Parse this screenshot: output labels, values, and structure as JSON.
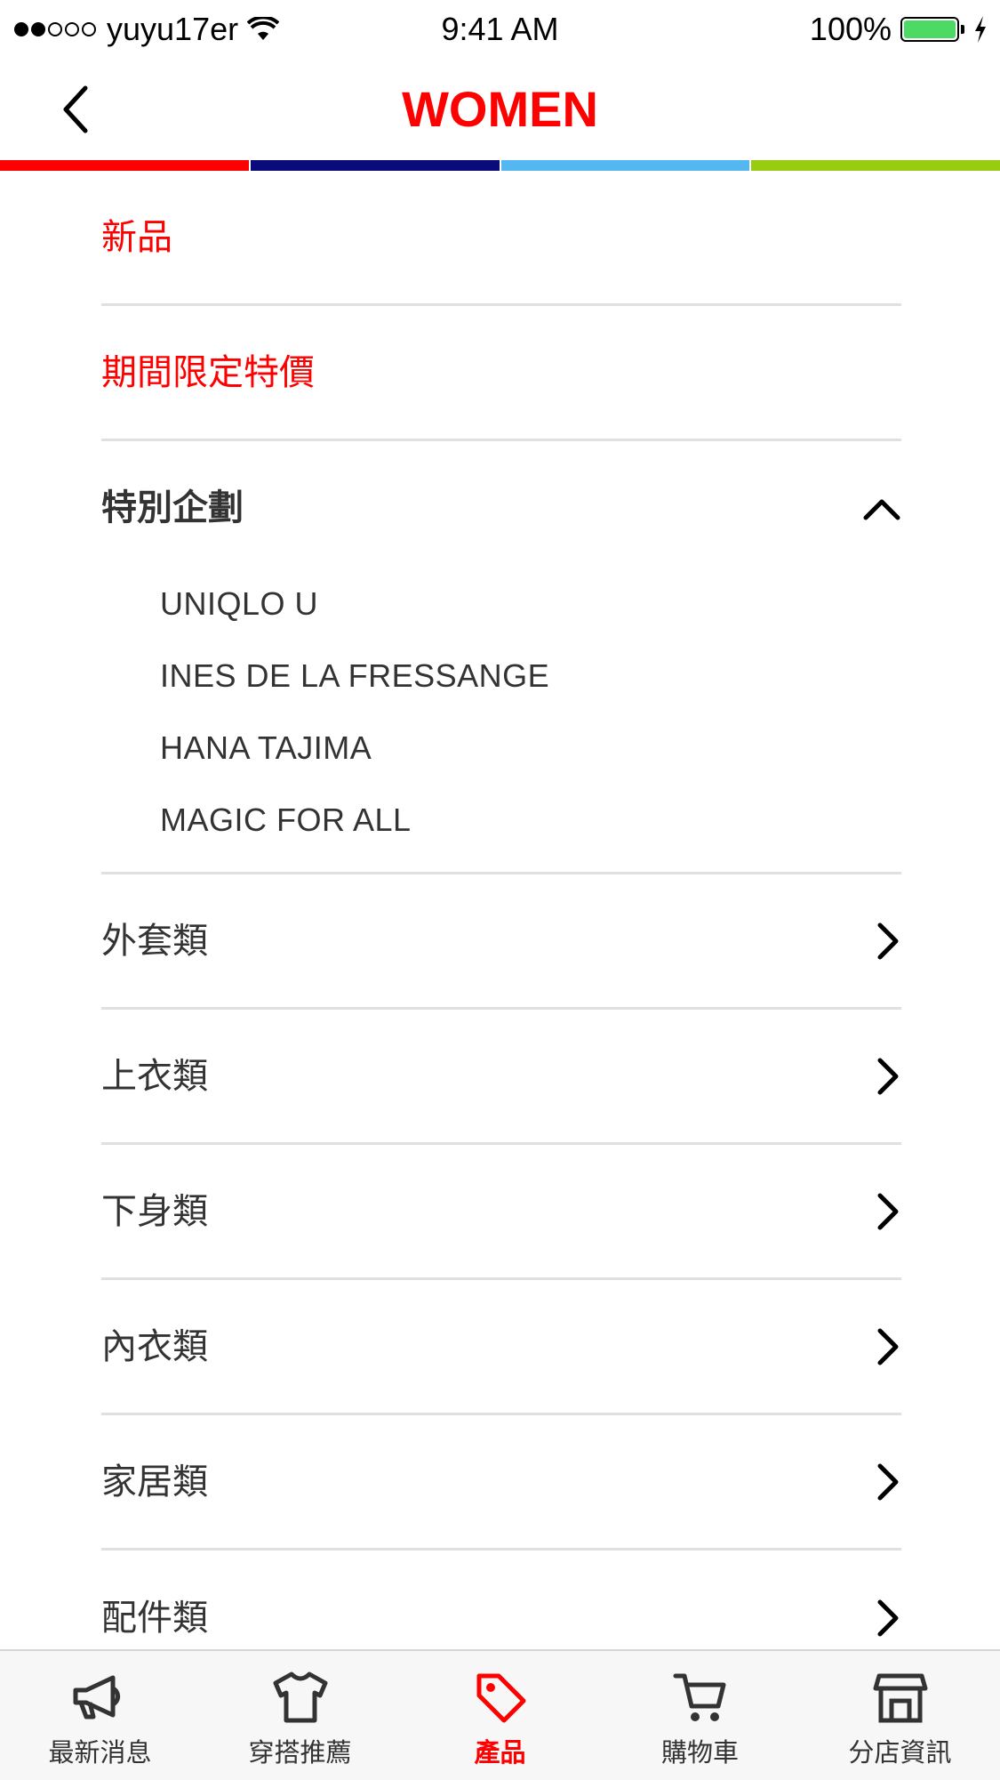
{
  "status_bar": {
    "carrier": "yuyu17er",
    "time": "9:41 AM",
    "battery": "100%"
  },
  "nav": {
    "title": "WOMEN",
    "title_color": "#ff0000"
  },
  "color_strip": [
    "#ff0000",
    "#0a0a7a",
    "#55b7ef",
    "#99cc11"
  ],
  "menu": {
    "new": "新品",
    "limited": "期間限定特價",
    "special": {
      "label": "特別企劃",
      "items": [
        "UNIQLO U",
        "INES DE LA FRESSANGE",
        "HANA TAJIMA",
        "MAGIC FOR ALL"
      ]
    },
    "categories": [
      "外套類",
      "上衣類",
      "下身類",
      "內衣類",
      "家居類",
      "配件類"
    ]
  },
  "tabs": [
    {
      "label": "最新消息",
      "icon": "megaphone-icon"
    },
    {
      "label": "穿搭推薦",
      "icon": "tshirt-icon"
    },
    {
      "label": "產品",
      "icon": "tag-icon",
      "active": true
    },
    {
      "label": "購物車",
      "icon": "cart-icon"
    },
    {
      "label": "分店資訊",
      "icon": "store-icon"
    }
  ]
}
